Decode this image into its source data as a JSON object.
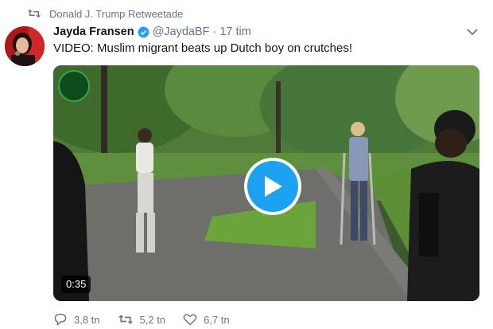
{
  "retweet_context": {
    "text": "Donald J. Trump Retweetade",
    "icon": "retweet-icon"
  },
  "tweet": {
    "author_name": "Jayda Fransen",
    "author_handle": "@JaydaBF",
    "separator": "·",
    "time": "17 tim",
    "text": "VIDEO: Muslim migrant beats up Dutch boy on crutches!",
    "verified": true
  },
  "media": {
    "type": "video",
    "duration": "0:35",
    "play_icon": "play-icon",
    "accent_color": "#1da1f2"
  },
  "actions": {
    "reply_count": "3,8 tn",
    "retweet_count": "5,2 tn",
    "like_count": "6,7 tn"
  },
  "colors": {
    "text": "#14171a",
    "muted": "#657786",
    "verified_blue": "#1da1f2"
  }
}
